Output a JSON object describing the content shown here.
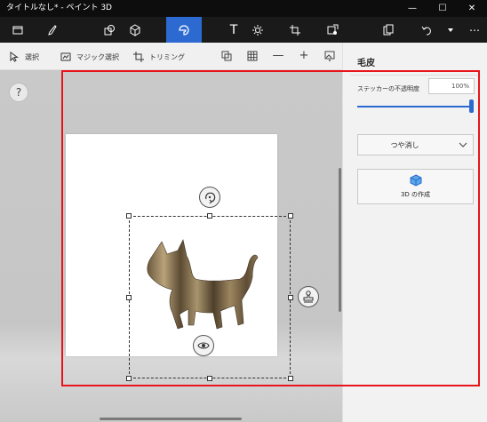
{
  "window": {
    "title": "タイトルなし* - ペイント 3D",
    "minimize": "—",
    "maximize": "☐",
    "close": "✕"
  },
  "ribbon": {
    "tools": [
      {
        "name": "menu-icon"
      },
      {
        "name": "brush-icon"
      },
      {
        "name": "2d-shapes-icon"
      },
      {
        "name": "3d-shapes-icon"
      },
      {
        "name": "stickers-icon",
        "active": true
      },
      {
        "name": "text-icon"
      },
      {
        "name": "effects-icon"
      },
      {
        "name": "canvas-icon"
      },
      {
        "name": "3d-library-icon"
      },
      {
        "name": "paste-icon"
      },
      {
        "name": "undo-icon"
      },
      {
        "name": "history-dropdown-icon"
      },
      {
        "name": "more-icon"
      }
    ],
    "text_tool_glyph": "T",
    "more_glyph": "⋯"
  },
  "subbar": {
    "select_label": "選択",
    "magic_select_label": "マジック選択",
    "crop_label": "トリミング",
    "zoom_out_glyph": "—",
    "zoom_in_glyph": "+"
  },
  "canvas": {
    "help_glyph": "?"
  },
  "panel": {
    "title": "毛皮",
    "opacity_label": "ステッカーの不透明度",
    "opacity_value": "100%",
    "opacity_level": 1.0,
    "finish_dropdown": "つや消し",
    "make_3d_label": "3D の作成"
  },
  "colors": {
    "accent": "#2c6ad2",
    "highlight": "#e8141c",
    "titlebar": "#0d0d0d",
    "ribbon": "#1a1a1a"
  }
}
